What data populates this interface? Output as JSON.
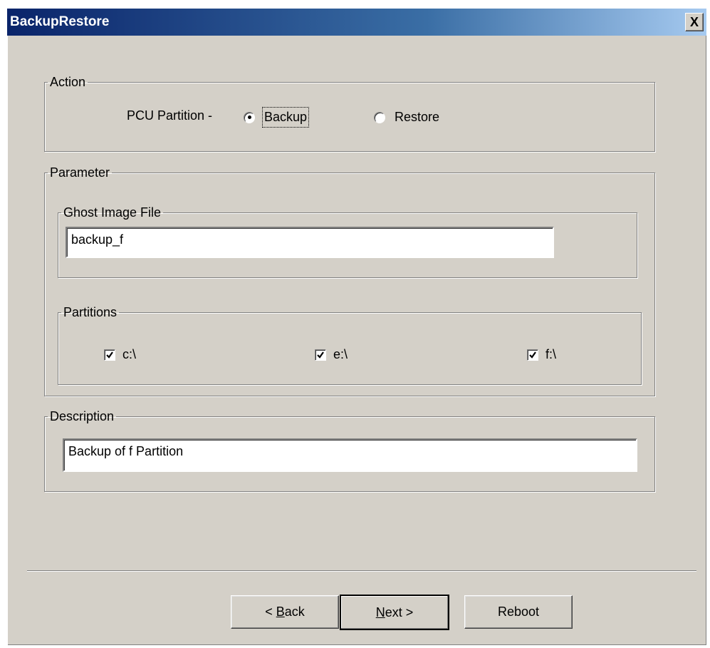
{
  "window": {
    "title": "BackupRestore",
    "close_glyph": "X"
  },
  "action": {
    "legend": "Action",
    "pcu_label": "PCU Partition -",
    "options": [
      {
        "label": "Backup",
        "selected": true
      },
      {
        "label": "Restore",
        "selected": false
      }
    ]
  },
  "parameter": {
    "legend": "Parameter",
    "ghost": {
      "legend": "Ghost Image File",
      "value": "backup_f"
    },
    "partitions": {
      "legend": "Partitions",
      "items": [
        {
          "label": "c:\\",
          "checked": true
        },
        {
          "label": "e:\\",
          "checked": true
        },
        {
          "label": "f:\\",
          "checked": true
        }
      ]
    }
  },
  "description": {
    "legend": "Description",
    "value": "Backup of f Partition"
  },
  "buttons": {
    "back": {
      "prefix": "< ",
      "mnemonic": "B",
      "rest": "ack"
    },
    "next": {
      "mnemonic": "N",
      "rest": "ext >"
    },
    "reboot": "Reboot"
  },
  "icons": {
    "check": "check-icon",
    "close": "close-icon",
    "radio_dot": "radio-dot-icon"
  }
}
